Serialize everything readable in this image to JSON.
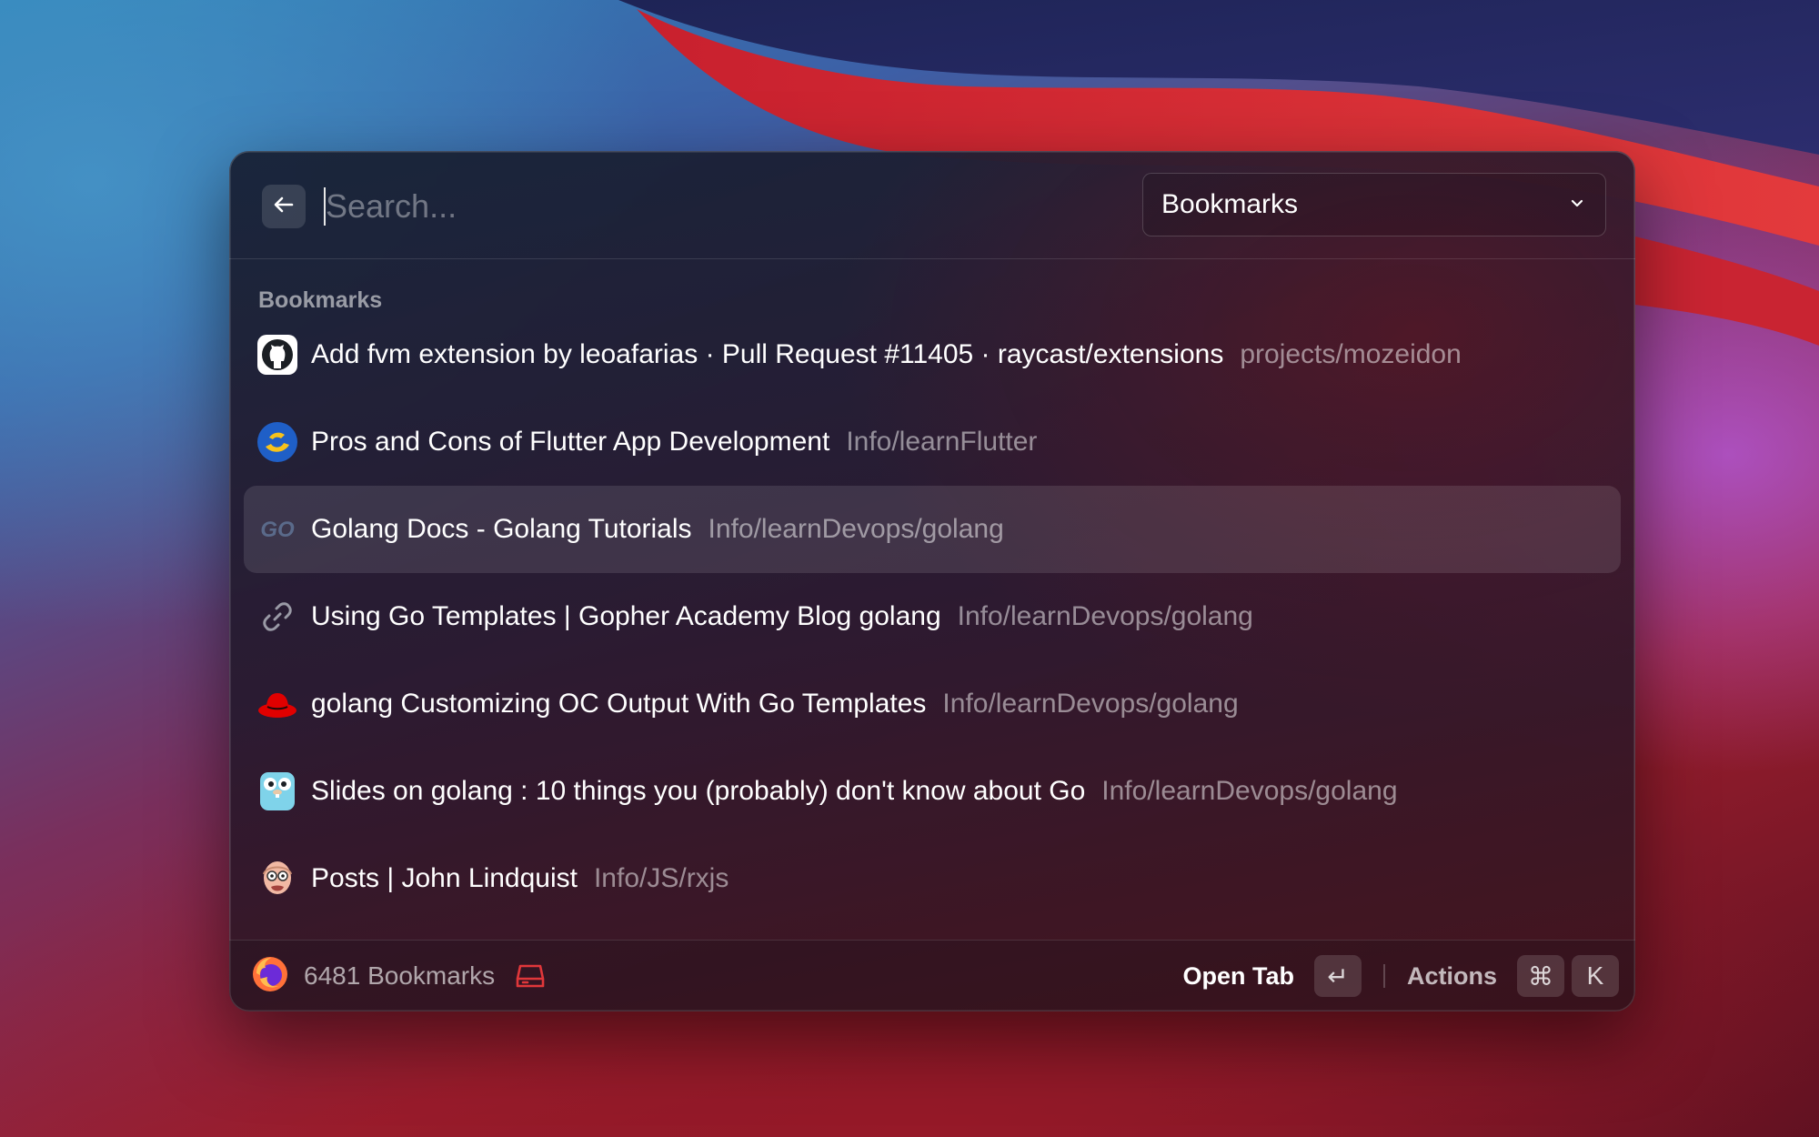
{
  "search": {
    "placeholder": "Search..."
  },
  "filter": {
    "selected": "Bookmarks"
  },
  "section": {
    "title": "Bookmarks"
  },
  "bookmarks": [
    {
      "title": "Add fvm extension by leoafarias · Pull Request #11405 · raycast/extensions",
      "folder": "projects/mozeidon",
      "icon": "github-icon"
    },
    {
      "title": "Pros and Cons of Flutter App Development",
      "folder": "Info/learnFlutter",
      "icon": "flutter-site-icon"
    },
    {
      "title": "Golang Docs - Golang Tutorials",
      "folder": "Info/learnDevops/golang",
      "icon": "go-logo-icon"
    },
    {
      "title": "Using Go Templates | Gopher Academy Blog golang",
      "folder": "Info/learnDevops/golang",
      "icon": "link-icon"
    },
    {
      "title": "golang Customizing OC Output With Go Templates",
      "folder": "Info/learnDevops/golang",
      "icon": "redhat-icon"
    },
    {
      "title": "Slides on golang : 10 things you (probably) don't know about Go",
      "folder": "Info/learnDevops/golang",
      "icon": "gopher-icon"
    },
    {
      "title": "Posts | John Lindquist",
      "folder": "Info/JS/rxjs",
      "icon": "avatar-icon"
    }
  ],
  "footer": {
    "count": "6481 Bookmarks",
    "primary_action": "Open Tab",
    "primary_key": "↵",
    "secondary_action": "Actions",
    "secondary_keys": [
      "⌘",
      "K"
    ]
  },
  "colors": {
    "selected_row": "#3a3346",
    "accent_red": "#e0373a"
  }
}
